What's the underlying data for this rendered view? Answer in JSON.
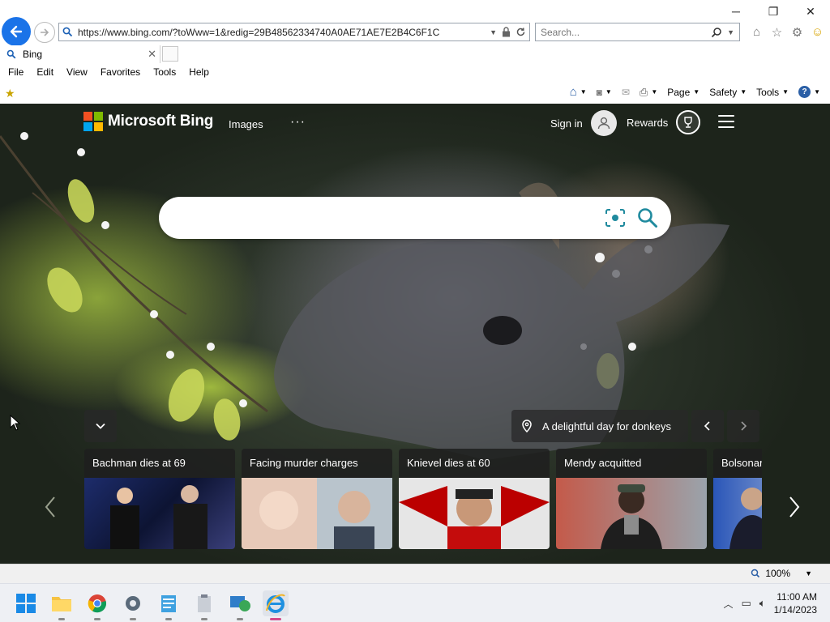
{
  "window": {
    "minimize_glyph": "─",
    "maximize_glyph": "❐",
    "close_glyph": "✕"
  },
  "address": {
    "url": "https://www.bing.com/?toWww=1&redig=29B48562334740A0AE71AE7E2B4C6F1C"
  },
  "search_bar": {
    "placeholder": "Search..."
  },
  "tab": {
    "title": "Bing"
  },
  "menu": [
    "File",
    "Edit",
    "View",
    "Favorites",
    "Tools",
    "Help"
  ],
  "command_bar": {
    "page": "Page",
    "safety": "Safety",
    "tools": "Tools"
  },
  "bing": {
    "brand": "Microsoft Bing",
    "nav_images": "Images",
    "nav_more": "···",
    "sign_in": "Sign in",
    "rewards": "Rewards",
    "search_placeholder": "",
    "image_caption": "A delightful day for donkeys",
    "news": [
      {
        "title": "Bachman dies at 69"
      },
      {
        "title": "Facing murder charges"
      },
      {
        "title": "Knievel dies at 60"
      },
      {
        "title": "Mendy acquitted"
      },
      {
        "title": "Bolsonar"
      }
    ]
  },
  "status": {
    "zoom": "100%"
  },
  "taskbar": {
    "time": "11:00 AM",
    "date": "1/14/2023"
  },
  "colors": {
    "accent_blue": "#1a73e8",
    "bing_teal": "#1f8a9e",
    "ms_red": "#f25022",
    "ms_green": "#7fba00",
    "ms_blue": "#00a4ef",
    "ms_yellow": "#ffb900"
  }
}
